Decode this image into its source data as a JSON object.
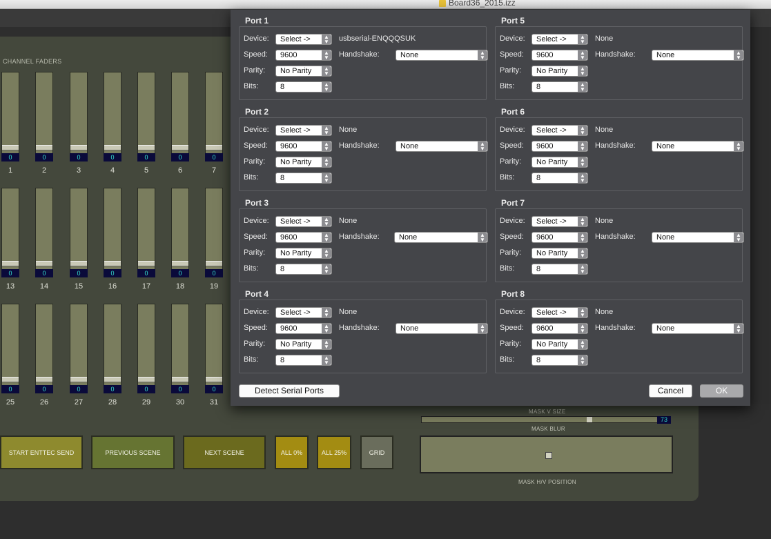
{
  "window": {
    "title": "Board36_2015.izz"
  },
  "board": {
    "section_label": "CHANNEL FADERS",
    "fader_rows": [
      {
        "numbers": [
          "1",
          "2",
          "3",
          "4",
          "5",
          "6",
          "7"
        ],
        "values": [
          "0",
          "0",
          "0",
          "0",
          "0",
          "0",
          "0"
        ]
      },
      {
        "numbers": [
          "13",
          "14",
          "15",
          "16",
          "17",
          "18",
          "19"
        ],
        "values": [
          "0",
          "0",
          "0",
          "0",
          "0",
          "0",
          "0"
        ]
      },
      {
        "numbers": [
          "25",
          "26",
          "27",
          "28",
          "29",
          "30",
          "31"
        ],
        "values": [
          "0",
          "0",
          "0",
          "0",
          "0",
          "0",
          "0"
        ]
      }
    ],
    "buttons": [
      {
        "label": "START ENTTEC SEND",
        "color": "#8e8a2e"
      },
      {
        "label": "PREVIOUS SCENE",
        "color": "#667432"
      },
      {
        "label": "NEXT SCENE",
        "color": "#6b6a1e"
      },
      {
        "label": "ALL 0%",
        "color": "#a38c12"
      },
      {
        "label": "ALL 25%",
        "color": "#a38c12"
      },
      {
        "label": "GRID",
        "color": "#6a6d5c"
      }
    ],
    "mask": {
      "v_size_label": "MASK V SIZE",
      "blur_label": "MASK BLUR",
      "blur_value": "73",
      "hv_label": "MASK H/V POSITION"
    }
  },
  "dialog": {
    "labels": {
      "device": "Device:",
      "speed": "Speed:",
      "parity": "Parity:",
      "bits": "Bits:",
      "handshake": "Handshake:"
    },
    "ports": [
      {
        "title": "Port 1",
        "device": "Select ->",
        "device_info": "usbserial-ENQQQSUK",
        "speed": "9600",
        "handshake": "None",
        "parity": "No Parity",
        "bits": "8"
      },
      {
        "title": "Port 2",
        "device": "Select ->",
        "device_info": "None",
        "speed": "9600",
        "handshake": "None",
        "parity": "No Parity",
        "bits": "8"
      },
      {
        "title": "Port 3",
        "device": "Select ->",
        "device_info": "None",
        "speed": "9600",
        "handshake": "None",
        "parity": "No Parity",
        "bits": "8"
      },
      {
        "title": "Port 4",
        "device": "Select ->",
        "device_info": "None",
        "speed": "9600",
        "handshake": "None",
        "parity": "No Parity",
        "bits": "8"
      },
      {
        "title": "Port 5",
        "device": "Select ->",
        "device_info": "None",
        "speed": "9600",
        "handshake": "None",
        "parity": "No Parity",
        "bits": "8"
      },
      {
        "title": "Port 6",
        "device": "Select ->",
        "device_info": "None",
        "speed": "9600",
        "handshake": "None",
        "parity": "No Parity",
        "bits": "8"
      },
      {
        "title": "Port 7",
        "device": "Select ->",
        "device_info": "None",
        "speed": "9600",
        "handshake": "None",
        "parity": "No Parity",
        "bits": "8"
      },
      {
        "title": "Port 8",
        "device": "Select ->",
        "device_info": "None",
        "speed": "9600",
        "handshake": "None",
        "parity": "No Parity",
        "bits": "8"
      }
    ],
    "detect_button": "Detect Serial Ports",
    "cancel_button": "Cancel",
    "ok_button": "OK"
  }
}
